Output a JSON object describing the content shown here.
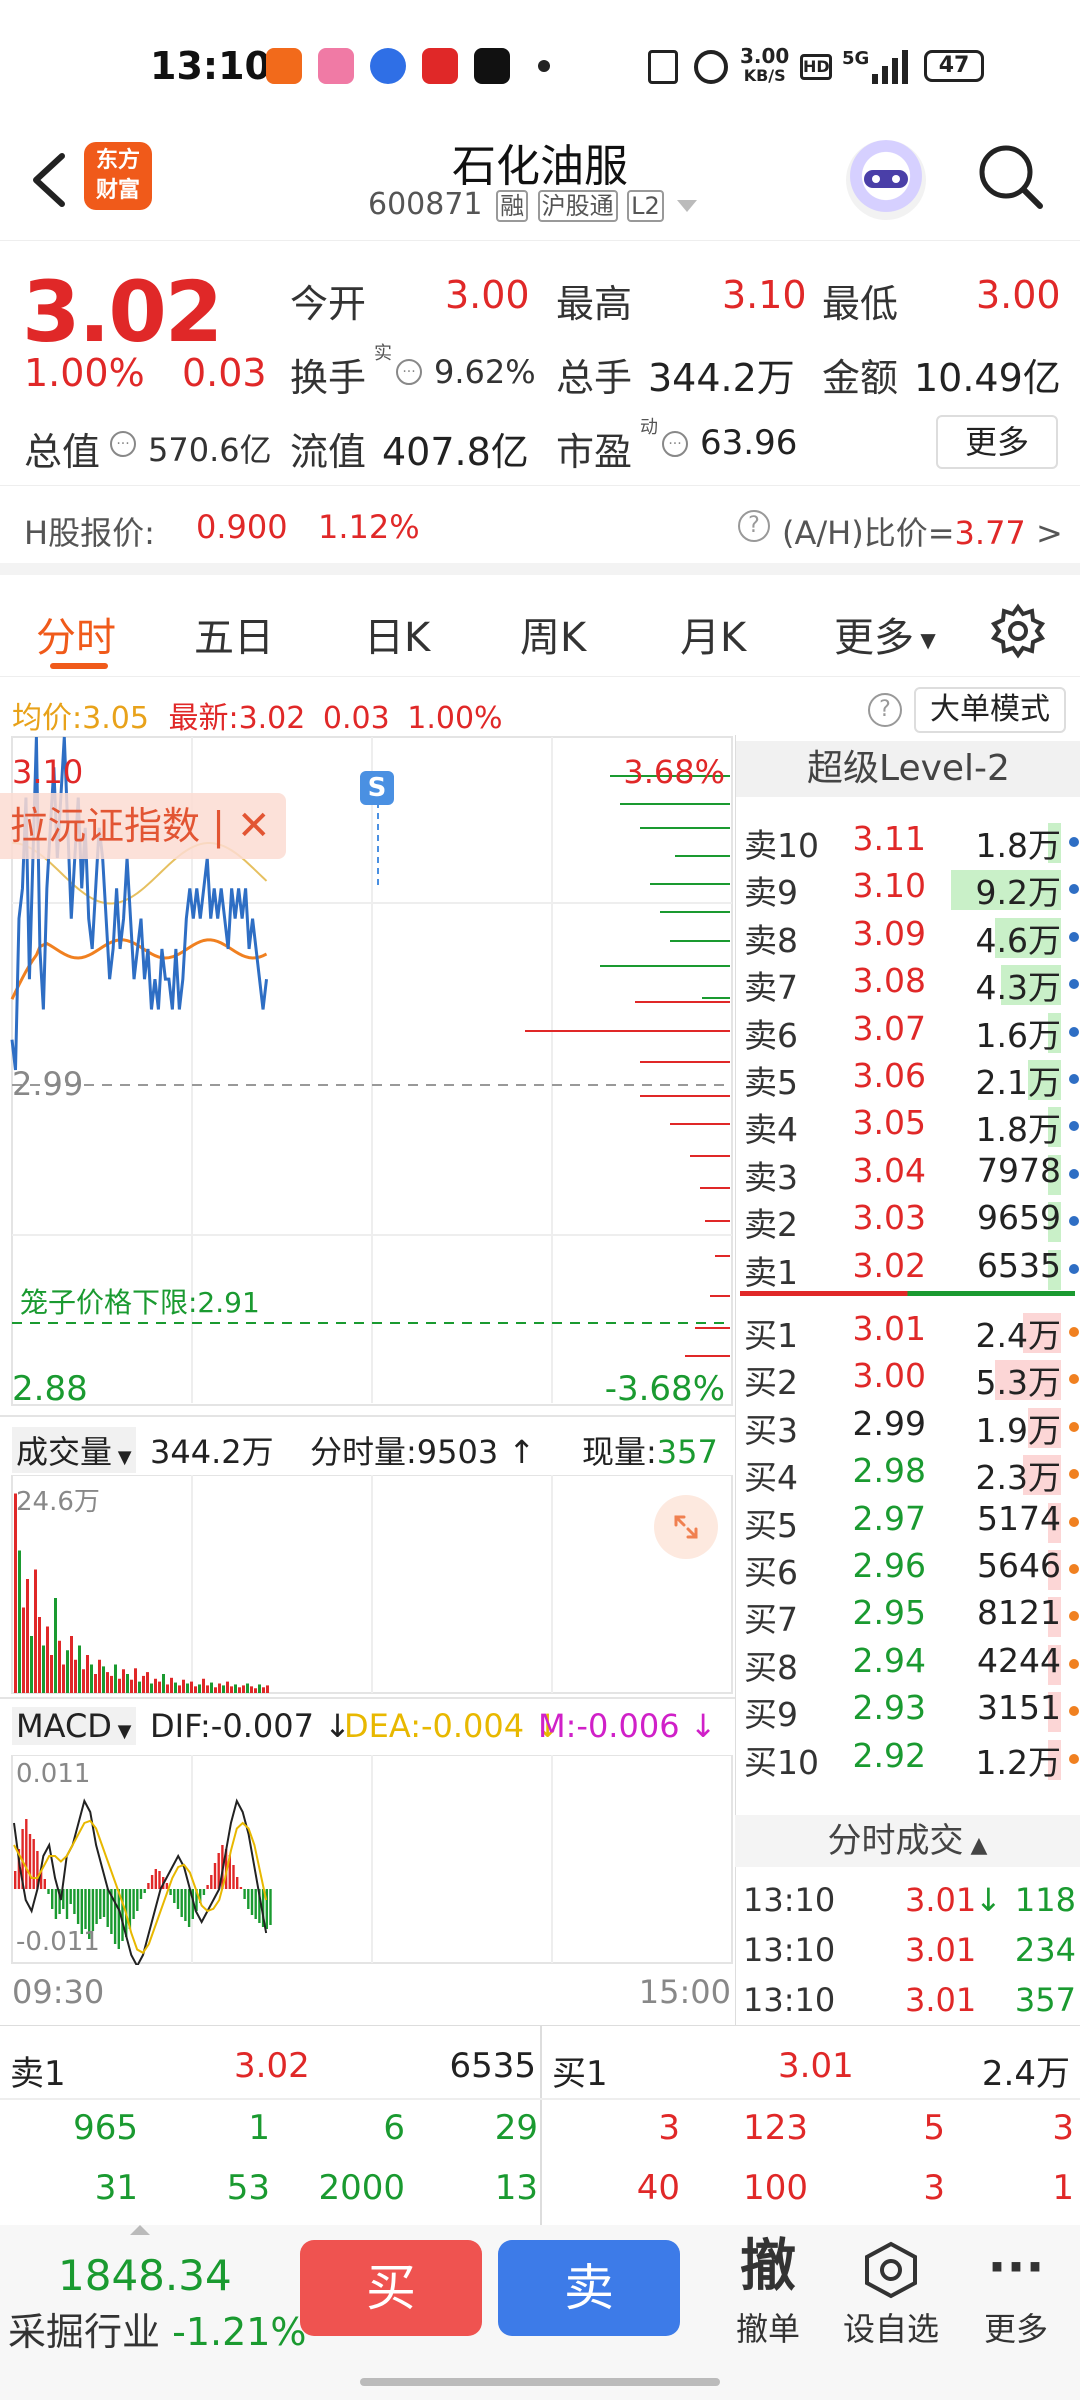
{
  "status": {
    "time": "13:10",
    "net_speed": "3.00",
    "net_unit": "KB/S",
    "signal": "5G",
    "battery": "47"
  },
  "header": {
    "logo_top": "东方",
    "logo_bottom": "财富",
    "title": "石化油服",
    "code": "600871",
    "tags": [
      "融",
      "沪股通",
      "L2"
    ]
  },
  "quote": {
    "price": "3.02",
    "change_pct": "1.00%",
    "change": "0.03",
    "open_label": "今开",
    "open": "3.00",
    "high_label": "最高",
    "high": "3.10",
    "low_label": "最低",
    "low": "3.00",
    "turnover_label": "换手",
    "turnover_sup": "实",
    "turnover": "9.62%",
    "volume_label": "总手",
    "volume": "344.2万",
    "amount_label": "金额",
    "amount": "10.49亿",
    "mcap_label": "总值",
    "mcap": "570.6亿",
    "float_label": "流值",
    "float": "407.8亿",
    "pe_label": "市盈",
    "pe_sup": "动",
    "pe": "63.96",
    "more": "更多"
  },
  "hshare": {
    "label": "H股报价:",
    "price": "0.900",
    "pct": "1.12%",
    "ah_label": "(A/H)比价=",
    "ah": "3.77"
  },
  "tabs": [
    "分时",
    "五日",
    "日K",
    "周K",
    "月K",
    "更多"
  ],
  "avg": {
    "avg_label": "均价:",
    "avg": "3.05",
    "latest_label": "最新:",
    "latest": "3.02",
    "chg": "0.03",
    "pct": "1.00%",
    "mode": "大单模式"
  },
  "chart": {
    "ymax": "3.10",
    "ymid": "2.99",
    "ymin": "2.88",
    "pmax": "3.68%",
    "pmin": "-3.68%",
    "overlay": "拉沅证指数",
    "cage": "笼子价格下限:2.91",
    "signal": "S",
    "vol_label": "成交量",
    "vol_total": "344.2万",
    "tick_vol": "分时量:9503",
    "now_vol_label": "现量:",
    "now_vol": "357",
    "vol_max": "24.6万",
    "macd_label": "MACD",
    "dif": "DIF:-0.007",
    "dea": "DEA:-0.004",
    "m": "M:-0.006",
    "macd_max": "0.011",
    "macd_min": "-0.011",
    "t_start": "09:30",
    "t_end": "15:00"
  },
  "orderbook": {
    "title": "超级Level-2",
    "asks": [
      {
        "l": "卖10",
        "p": "3.11",
        "v": "1.8万"
      },
      {
        "l": "卖9",
        "p": "3.10",
        "v": "9.2万"
      },
      {
        "l": "卖8",
        "p": "3.09",
        "v": "4.6万"
      },
      {
        "l": "卖7",
        "p": "3.08",
        "v": "4.3万"
      },
      {
        "l": "卖6",
        "p": "3.07",
        "v": "1.6万"
      },
      {
        "l": "卖5",
        "p": "3.06",
        "v": "2.1万"
      },
      {
        "l": "卖4",
        "p": "3.05",
        "v": "1.8万"
      },
      {
        "l": "卖3",
        "p": "3.04",
        "v": "7978"
      },
      {
        "l": "卖2",
        "p": "3.03",
        "v": "9659"
      },
      {
        "l": "卖1",
        "p": "3.02",
        "v": "6535"
      }
    ],
    "bids": [
      {
        "l": "买1",
        "p": "3.01",
        "v": "2.4万"
      },
      {
        "l": "买2",
        "p": "3.00",
        "v": "5.3万"
      },
      {
        "l": "买3",
        "p": "2.99",
        "v": "1.9万"
      },
      {
        "l": "买4",
        "p": "2.98",
        "v": "2.3万"
      },
      {
        "l": "买5",
        "p": "2.97",
        "v": "5174"
      },
      {
        "l": "买6",
        "p": "2.96",
        "v": "5646"
      },
      {
        "l": "买7",
        "p": "2.95",
        "v": "8121"
      },
      {
        "l": "买8",
        "p": "2.94",
        "v": "4244"
      },
      {
        "l": "买9",
        "p": "2.93",
        "v": "3151"
      },
      {
        "l": "买10",
        "p": "2.92",
        "v": "1.2万"
      }
    ],
    "trades_title": "分时成交",
    "trades": [
      {
        "t": "13:10",
        "p": "3.01",
        "v": "118"
      },
      {
        "t": "13:10",
        "p": "3.01",
        "v": "234"
      },
      {
        "t": "13:10",
        "p": "3.01",
        "v": "357"
      }
    ]
  },
  "queue": {
    "ask_label": "卖1",
    "ask_price": "3.02",
    "ask_vol": "6535",
    "bid_label": "买1",
    "bid_price": "3.01",
    "bid_vol": "2.4万",
    "ask_rows": [
      [
        "965",
        "1",
        "6",
        "29"
      ],
      [
        "31",
        "53",
        "2000",
        "13"
      ]
    ],
    "bid_rows": [
      [
        "3",
        "123",
        "5",
        "3"
      ],
      [
        "40",
        "100",
        "3",
        "1"
      ]
    ]
  },
  "footer": {
    "index_value": "1848.34",
    "index_name": "采掘行业",
    "index_pct": "-1.21%",
    "buy": "买",
    "sell": "卖",
    "cancel_icon": "撤",
    "cancel": "撤单",
    "watch": "设自选",
    "more": "更多"
  },
  "colors": {
    "up": "#e02828",
    "down": "#1a9a30",
    "brand": "#f05a1a",
    "buy_btn": "#ef5350",
    "sell_btn": "#3d7be8"
  }
}
